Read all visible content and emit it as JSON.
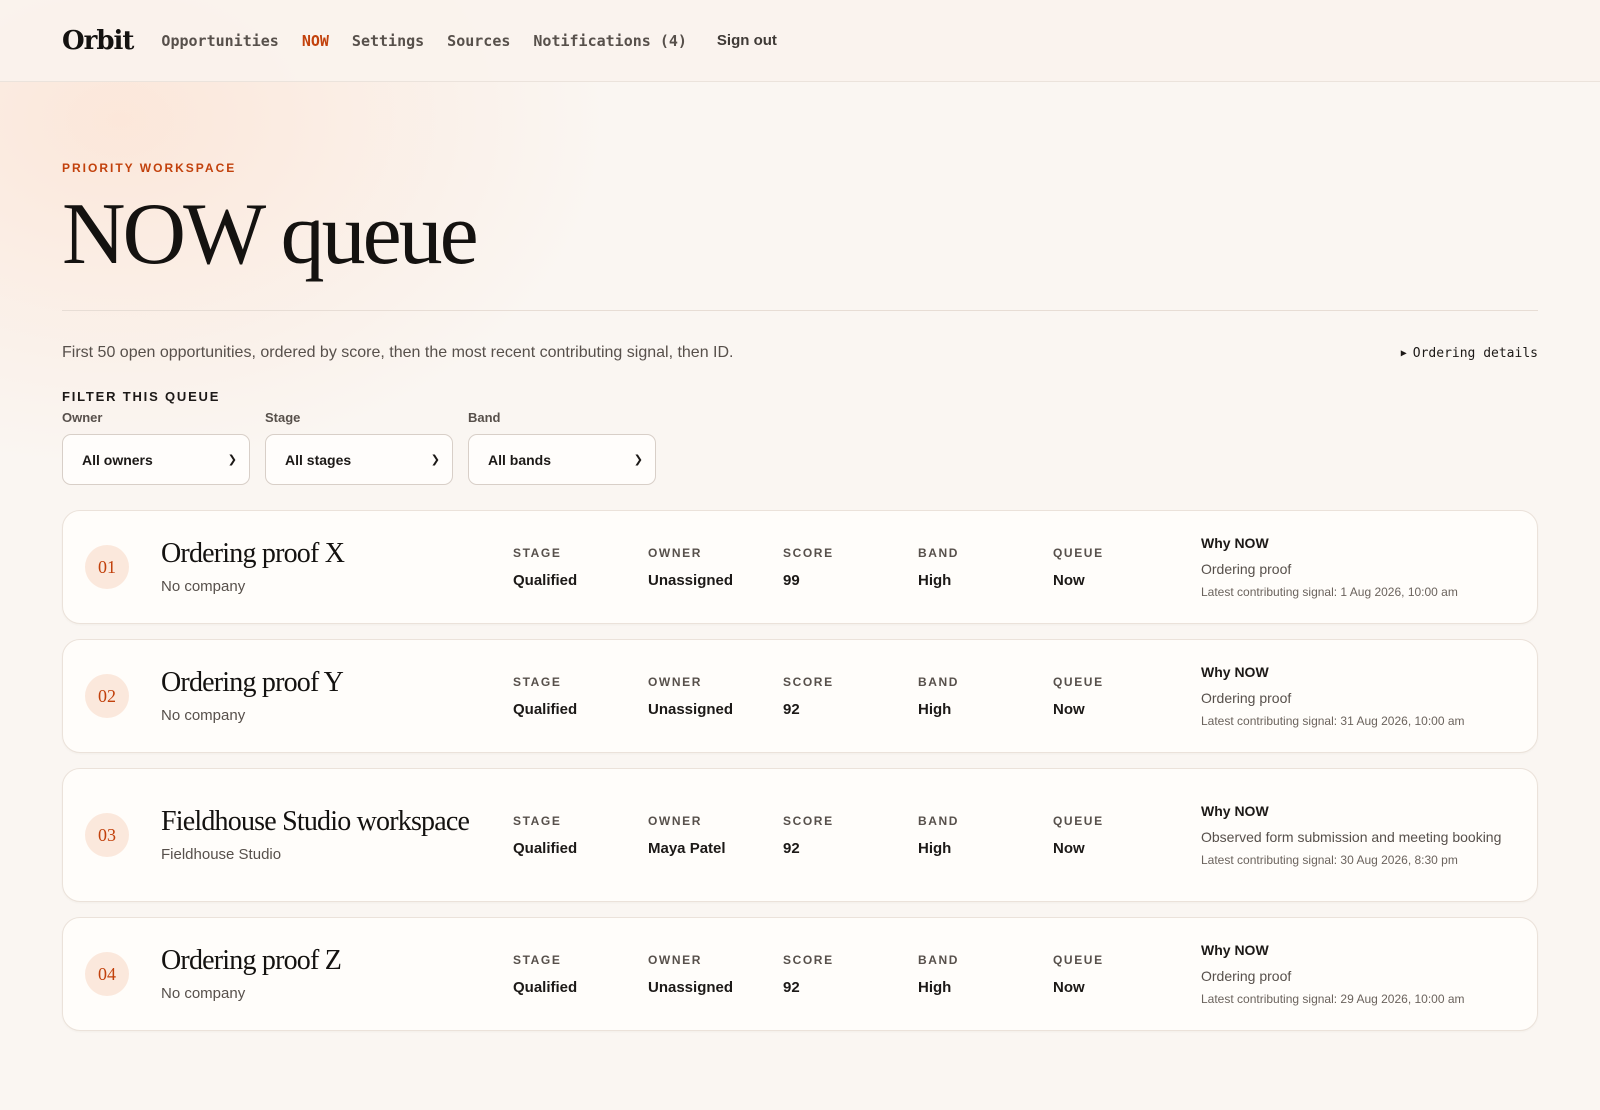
{
  "nav": {
    "brand": "Orbit",
    "items": [
      {
        "label": "Opportunities"
      },
      {
        "label": "NOW"
      },
      {
        "label": "Settings"
      },
      {
        "label": "Sources"
      },
      {
        "label": "Notifications (4)"
      }
    ],
    "active": "NOW",
    "signout": "Sign out"
  },
  "header": {
    "eyebrow": "PRIORITY WORKSPACE",
    "title": "NOW queue",
    "intro": "First 50 open opportunities, ordered by score, then the most recent contributing signal, then ID.",
    "details_toggle": "Ordering details"
  },
  "filters": {
    "title": "FILTER THIS QUEUE",
    "owner": {
      "label": "Owner",
      "value": "All owners"
    },
    "stage": {
      "label": "Stage",
      "value": "All stages"
    },
    "band": {
      "label": "Band",
      "value": "All bands"
    }
  },
  "field_labels": {
    "stage": "STAGE",
    "owner": "OWNER",
    "score": "SCORE",
    "band": "BAND",
    "queue": "QUEUE",
    "why": "Why NOW"
  },
  "opportunities": [
    {
      "rank": "01",
      "title": "Ordering proof X",
      "company": "No company",
      "stage": "Qualified",
      "owner": "Unassigned",
      "score": "99",
      "band": "High",
      "queue": "Now",
      "reason": "Ordering proof",
      "signal": "Latest contributing signal: 1 Aug 2026, 10:00 am"
    },
    {
      "rank": "02",
      "title": "Ordering proof Y",
      "company": "No company",
      "stage": "Qualified",
      "owner": "Unassigned",
      "score": "92",
      "band": "High",
      "queue": "Now",
      "reason": "Ordering proof",
      "signal": "Latest contributing signal: 31 Aug 2026, 10:00 am"
    },
    {
      "rank": "03",
      "title": "Fieldhouse Studio workspace",
      "company": "Fieldhouse Studio",
      "stage": "Qualified",
      "owner": "Maya Patel",
      "score": "92",
      "band": "High",
      "queue": "Now",
      "reason": "Observed form submission and meeting booking",
      "signal": "Latest contributing signal: 30 Aug 2026, 8:30 pm"
    },
    {
      "rank": "04",
      "title": "Ordering proof Z",
      "company": "No company",
      "stage": "Qualified",
      "owner": "Unassigned",
      "score": "92",
      "band": "High",
      "queue": "Now",
      "reason": "Ordering proof",
      "signal": "Latest contributing signal: 29 Aug 2026, 10:00 am"
    }
  ],
  "colors": {
    "accent": "#c2410c",
    "background": "#faf6f2",
    "card": "#fffdfa"
  }
}
